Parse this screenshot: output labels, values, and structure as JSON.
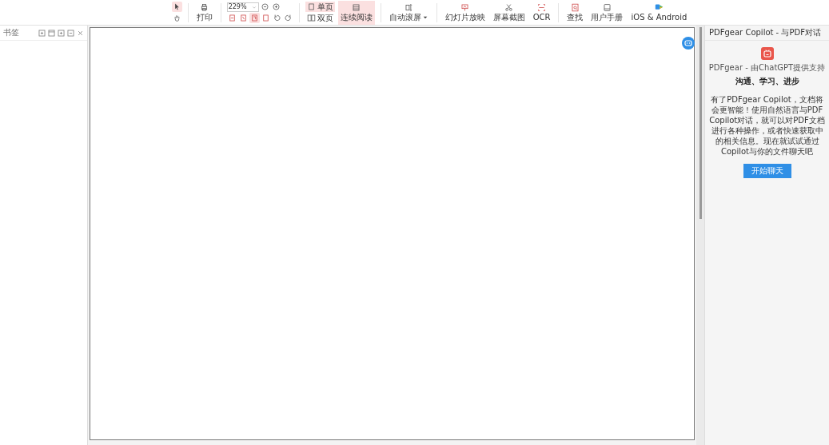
{
  "toolbar": {
    "pointer_tools": [
      {
        "kind": "select",
        "selected": true
      },
      {
        "kind": "hand",
        "selected": false
      }
    ],
    "print": {
      "label": "打印"
    },
    "zoom": {
      "value": "229%"
    },
    "fit_modes": [
      {
        "kind": "fit-width",
        "selected": false
      },
      {
        "kind": "fit-page",
        "selected": false
      },
      {
        "kind": "actual",
        "selected": true
      },
      {
        "kind": "fit-visible",
        "selected": false
      }
    ],
    "page_modes": [
      {
        "label": "单页",
        "selected": true
      },
      {
        "label": "双页",
        "selected": false
      }
    ],
    "continuous": {
      "label": "连续阅读",
      "selected": true
    },
    "actions": [
      {
        "kind": "scroll",
        "label": "自动滚屏",
        "dropdown": true
      },
      {
        "kind": "slideshow",
        "label": "幻灯片放映",
        "dropdown": false
      },
      {
        "kind": "screenshot",
        "label": "屏幕截图",
        "dropdown": false
      },
      {
        "kind": "ocr",
        "label": "OCR",
        "dropdown": false
      },
      {
        "kind": "find",
        "label": "查找",
        "dropdown": false
      },
      {
        "kind": "manual",
        "label": "用户手册",
        "dropdown": false
      },
      {
        "kind": "mobile",
        "label": "iOS & Android",
        "dropdown": false
      }
    ]
  },
  "sidebar": {
    "title": "书签"
  },
  "copilot": {
    "title": "PDFgear Copilot - 与PDF对话",
    "subtitle": "PDFgear - 由ChatGPT提供支持",
    "tagline": "沟通、学习、进步",
    "description": "有了PDFgear Copilot，文档将会更智能！使用自然语言与PDF Copilot对话，就可以对PDF文档进行各种操作，或者快速获取中的相关信息。现在就试试通过Copilot与你的文件聊天吧",
    "button": "开始聊天"
  }
}
